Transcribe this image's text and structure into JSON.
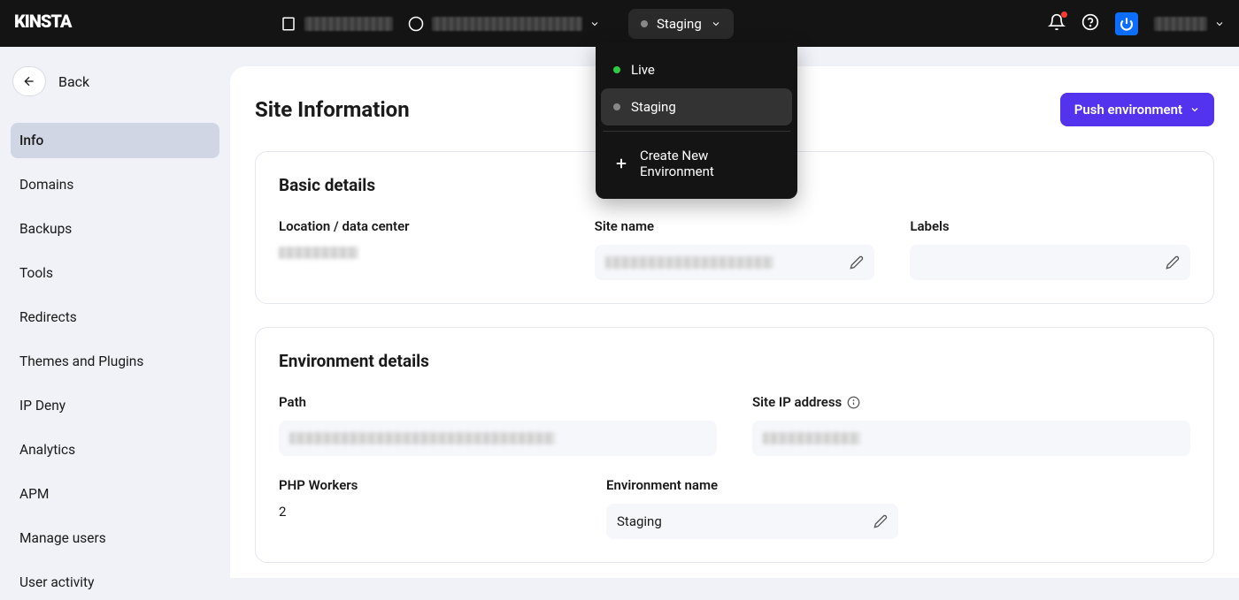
{
  "header": {
    "logo_text": "KINSTA",
    "env_selector_label": "Staging",
    "dropdown": {
      "items": [
        {
          "label": "Live",
          "dot": "green"
        },
        {
          "label": "Staging",
          "dot": "grey",
          "selected": true
        }
      ],
      "create_label": "Create New Environment"
    }
  },
  "sidebar": {
    "back_label": "Back",
    "items": [
      {
        "label": "Info",
        "active": true
      },
      {
        "label": "Domains"
      },
      {
        "label": "Backups"
      },
      {
        "label": "Tools"
      },
      {
        "label": "Redirects"
      },
      {
        "label": "Themes and Plugins"
      },
      {
        "label": "IP Deny"
      },
      {
        "label": "Analytics"
      },
      {
        "label": "APM"
      },
      {
        "label": "Manage users"
      },
      {
        "label": "User activity"
      }
    ]
  },
  "page": {
    "title": "Site Information",
    "push_button_label": "Push environment"
  },
  "basic_details": {
    "card_title": "Basic details",
    "location_label": "Location / data center",
    "site_name_label": "Site name",
    "labels_label": "Labels"
  },
  "environment_details": {
    "card_title": "Environment details",
    "path_label": "Path",
    "site_ip_label": "Site IP address",
    "php_workers_label": "PHP Workers",
    "php_workers_value": "2",
    "env_name_label": "Environment name",
    "env_name_value": "Staging"
  }
}
